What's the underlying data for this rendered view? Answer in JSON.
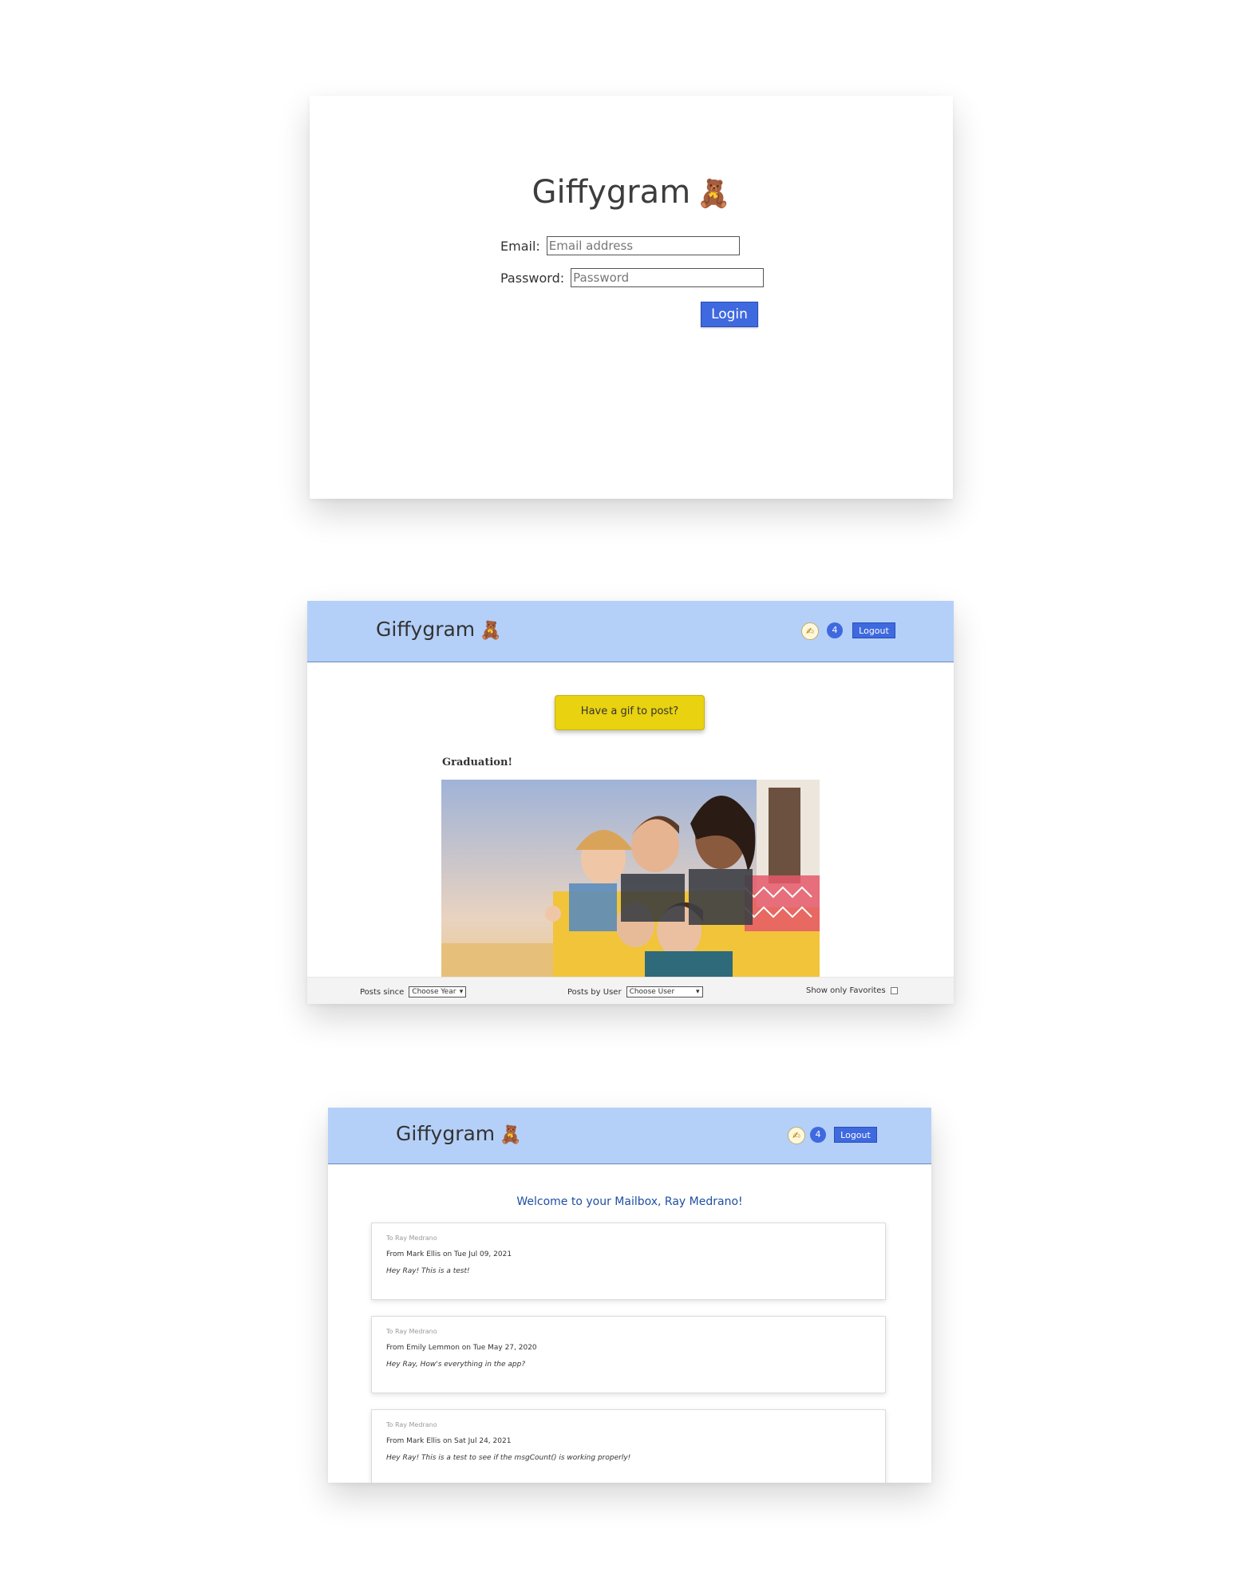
{
  "login": {
    "brand": "Giffygram",
    "brand_icon": "🧸",
    "email_label": "Email:",
    "email_placeholder": "Email address",
    "password_label": "Password:",
    "password_placeholder": "Password",
    "login_button": "Login"
  },
  "feed": {
    "nav": {
      "brand": "Giffygram",
      "brand_icon": "🧸",
      "pen_icon": "✍",
      "message_count": "4",
      "logout": "Logout"
    },
    "post_button": "Have a gif to post?",
    "post": {
      "title": "Graduation!",
      "image_icon": "photo-friends-in-van"
    },
    "footer": {
      "since_label": "Posts since",
      "since_value": "Choose Year",
      "user_label": "Posts by User",
      "user_value": "Choose User",
      "favorites_label": "Show only Favorites"
    }
  },
  "mailbox": {
    "nav": {
      "brand": "Giffygram",
      "brand_icon": "🧸",
      "pen_icon": "✍",
      "message_count": "4",
      "logout": "Logout"
    },
    "welcome": "Welcome to your Mailbox, Ray Medrano!",
    "messages": [
      {
        "to": "To Ray Medrano",
        "from": "From Mark Ellis on Tue Jul 09, 2021",
        "body": "Hey Ray! This is a test!"
      },
      {
        "to": "To Ray Medrano",
        "from": "From Emily Lemmon on Tue May 27, 2020",
        "body": "Hey Ray, How's everything in the app?"
      },
      {
        "to": "To Ray Medrano",
        "from": "From Mark Ellis on Sat Jul 24, 2021",
        "body": "Hey Ray! This is a test to see if the msgCount() is working properly!"
      }
    ]
  },
  "colors": {
    "nav_bg": "#b4d0f8",
    "accent_blue": "#3f69df",
    "post_button": "#e9d20f",
    "welcome_text": "#1e4fa3"
  }
}
